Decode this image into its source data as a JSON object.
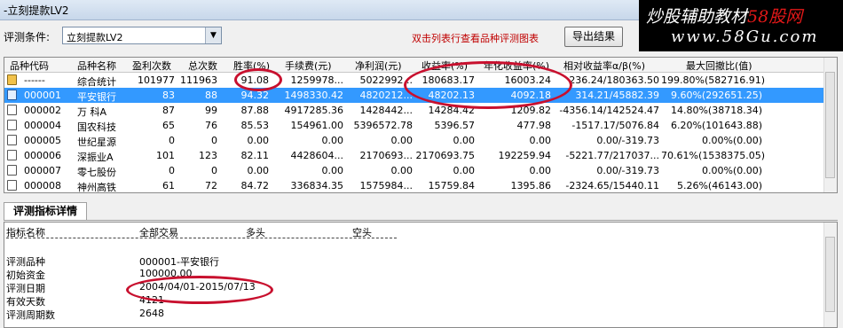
{
  "window": {
    "title": "-立刻提款LV2"
  },
  "brand": {
    "line1_prefix": "炒股辅助教材",
    "line1_accent": "58股网",
    "line2": "www.58Gu.com"
  },
  "toolbar": {
    "condition_label": "评测条件:",
    "condition_value": "立刻提款LV2",
    "hint": "双击列表行查看品种评测图表",
    "export_label": "导出结果"
  },
  "grid": {
    "columns": [
      "品种代码",
      "品种名称",
      "盈利次数",
      "总次数",
      "胜率(%)",
      "手续费(元)",
      "净利润(元)",
      "收益率(%)",
      "年化收益率(%)",
      "相对收益率α/β(%)",
      "最大回撤比(值)"
    ],
    "rows": [
      {
        "code": "------",
        "name": "综合统计",
        "wins": "101977",
        "total": "111963",
        "winrate": "91.08",
        "fee": "1259978...",
        "profit": "5022992...",
        "ret": "180683.17",
        "annual": "16003.24",
        "alpha": "236.24/180363.50",
        "drawdown": "199.80%(582716.91)",
        "icon": "sum"
      },
      {
        "code": "000001",
        "name": "平安银行",
        "wins": "83",
        "total": "88",
        "winrate": "94.32",
        "fee": "1498330.42",
        "profit": "4820212...",
        "ret": "48202.13",
        "annual": "4092.18",
        "alpha": "314.21/45882.39",
        "drawdown": "9.60%(292651.25)",
        "icon": "sel"
      },
      {
        "code": "000002",
        "name": "万  科A",
        "wins": "87",
        "total": "99",
        "winrate": "87.88",
        "fee": "4917285.36",
        "profit": "1428442...",
        "ret": "14284.42",
        "annual": "1209.82",
        "alpha": "-4356.14/142524.47",
        "drawdown": "14.80%(38718.34)",
        "icon": "doc"
      },
      {
        "code": "000004",
        "name": "国农科技",
        "wins": "65",
        "total": "76",
        "winrate": "85.53",
        "fee": "154961.00",
        "profit": "5396572.78",
        "ret": "5396.57",
        "annual": "477.98",
        "alpha": "-1517.17/5076.84",
        "drawdown": "6.20%(101643.88)",
        "icon": "doc"
      },
      {
        "code": "000005",
        "name": "世纪星源",
        "wins": "0",
        "total": "0",
        "winrate": "0.00",
        "fee": "0.00",
        "profit": "0.00",
        "ret": "0.00",
        "annual": "0.00",
        "alpha": "0.00/-319.73",
        "drawdown": "0.00%(0.00)",
        "icon": "doc"
      },
      {
        "code": "000006",
        "name": "深振业A",
        "wins": "101",
        "total": "123",
        "winrate": "82.11",
        "fee": "4428604...",
        "profit": "2170693...",
        "ret": "2170693.75",
        "annual": "192259.94",
        "alpha": "-5221.77/217037...",
        "drawdown": "70.61%(1538375.05)",
        "icon": "doc"
      },
      {
        "code": "000007",
        "name": "零七股份",
        "wins": "0",
        "total": "0",
        "winrate": "0.00",
        "fee": "0.00",
        "profit": "0.00",
        "ret": "0.00",
        "annual": "0.00",
        "alpha": "0.00/-319.73",
        "drawdown": "0.00%(0.00)",
        "icon": "doc"
      },
      {
        "code": "000008",
        "name": "神州高铁",
        "wins": "61",
        "total": "72",
        "winrate": "84.72",
        "fee": "336834.35",
        "profit": "1575984...",
        "ret": "15759.84",
        "annual": "1395.86",
        "alpha": "-2324.65/15440.11",
        "drawdown": "5.26%(46143.00)",
        "icon": "doc"
      }
    ]
  },
  "detail": {
    "tab": "评测指标详情",
    "headers": [
      "指标名称",
      "全部交易",
      "多头",
      "空头"
    ],
    "items": [
      {
        "label": "评测品种",
        "value": "000001-平安银行"
      },
      {
        "label": "初始资金",
        "value": "100000.00"
      },
      {
        "label": "评测日期",
        "value": "2004/04/01-2015/07/13"
      },
      {
        "label": "有效天数",
        "value": "4121"
      },
      {
        "label": "评测周期数",
        "value": "2648"
      }
    ]
  }
}
